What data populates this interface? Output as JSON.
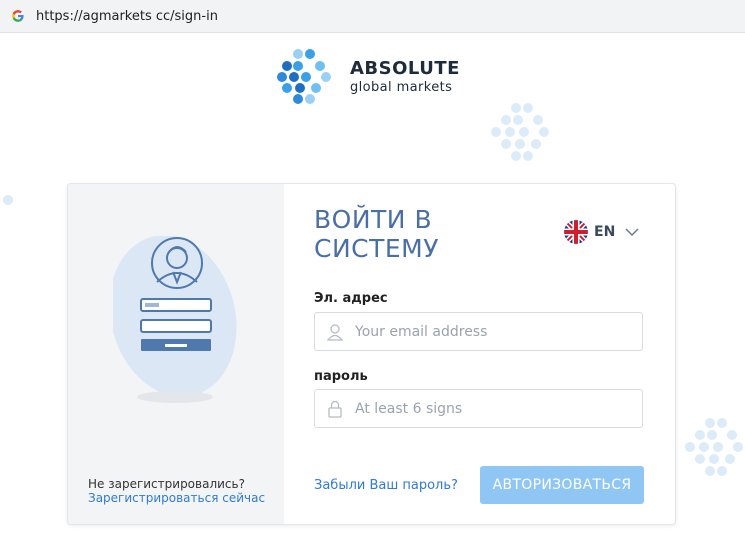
{
  "browser": {
    "url": "https://agmarkets cc/sign-in",
    "favicon_icon": "google-g-icon"
  },
  "brand": {
    "title": "ABSOLUTE",
    "subtitle": "global markets",
    "accent_color": "#3aa0e6"
  },
  "login": {
    "heading": "ВОЙТИ В СИСТЕМУ",
    "language": {
      "code": "EN",
      "flag_icon": "uk-flag-icon"
    },
    "email": {
      "label": "Эл. адрес",
      "placeholder": "Your email address",
      "value": "",
      "icon": "user-icon"
    },
    "password": {
      "label": "пароль",
      "placeholder": "At least 6 signs",
      "value": "",
      "icon": "lock-icon"
    },
    "forgot_link": "Забыли Ваш пароль?",
    "submit_label": "АВТОРИЗОВАТЬСЯ",
    "submit_color": "#8fc6f3"
  },
  "signup": {
    "question": "Не зарегистрировались?",
    "link": "Зарегистрироваться сейчас"
  }
}
